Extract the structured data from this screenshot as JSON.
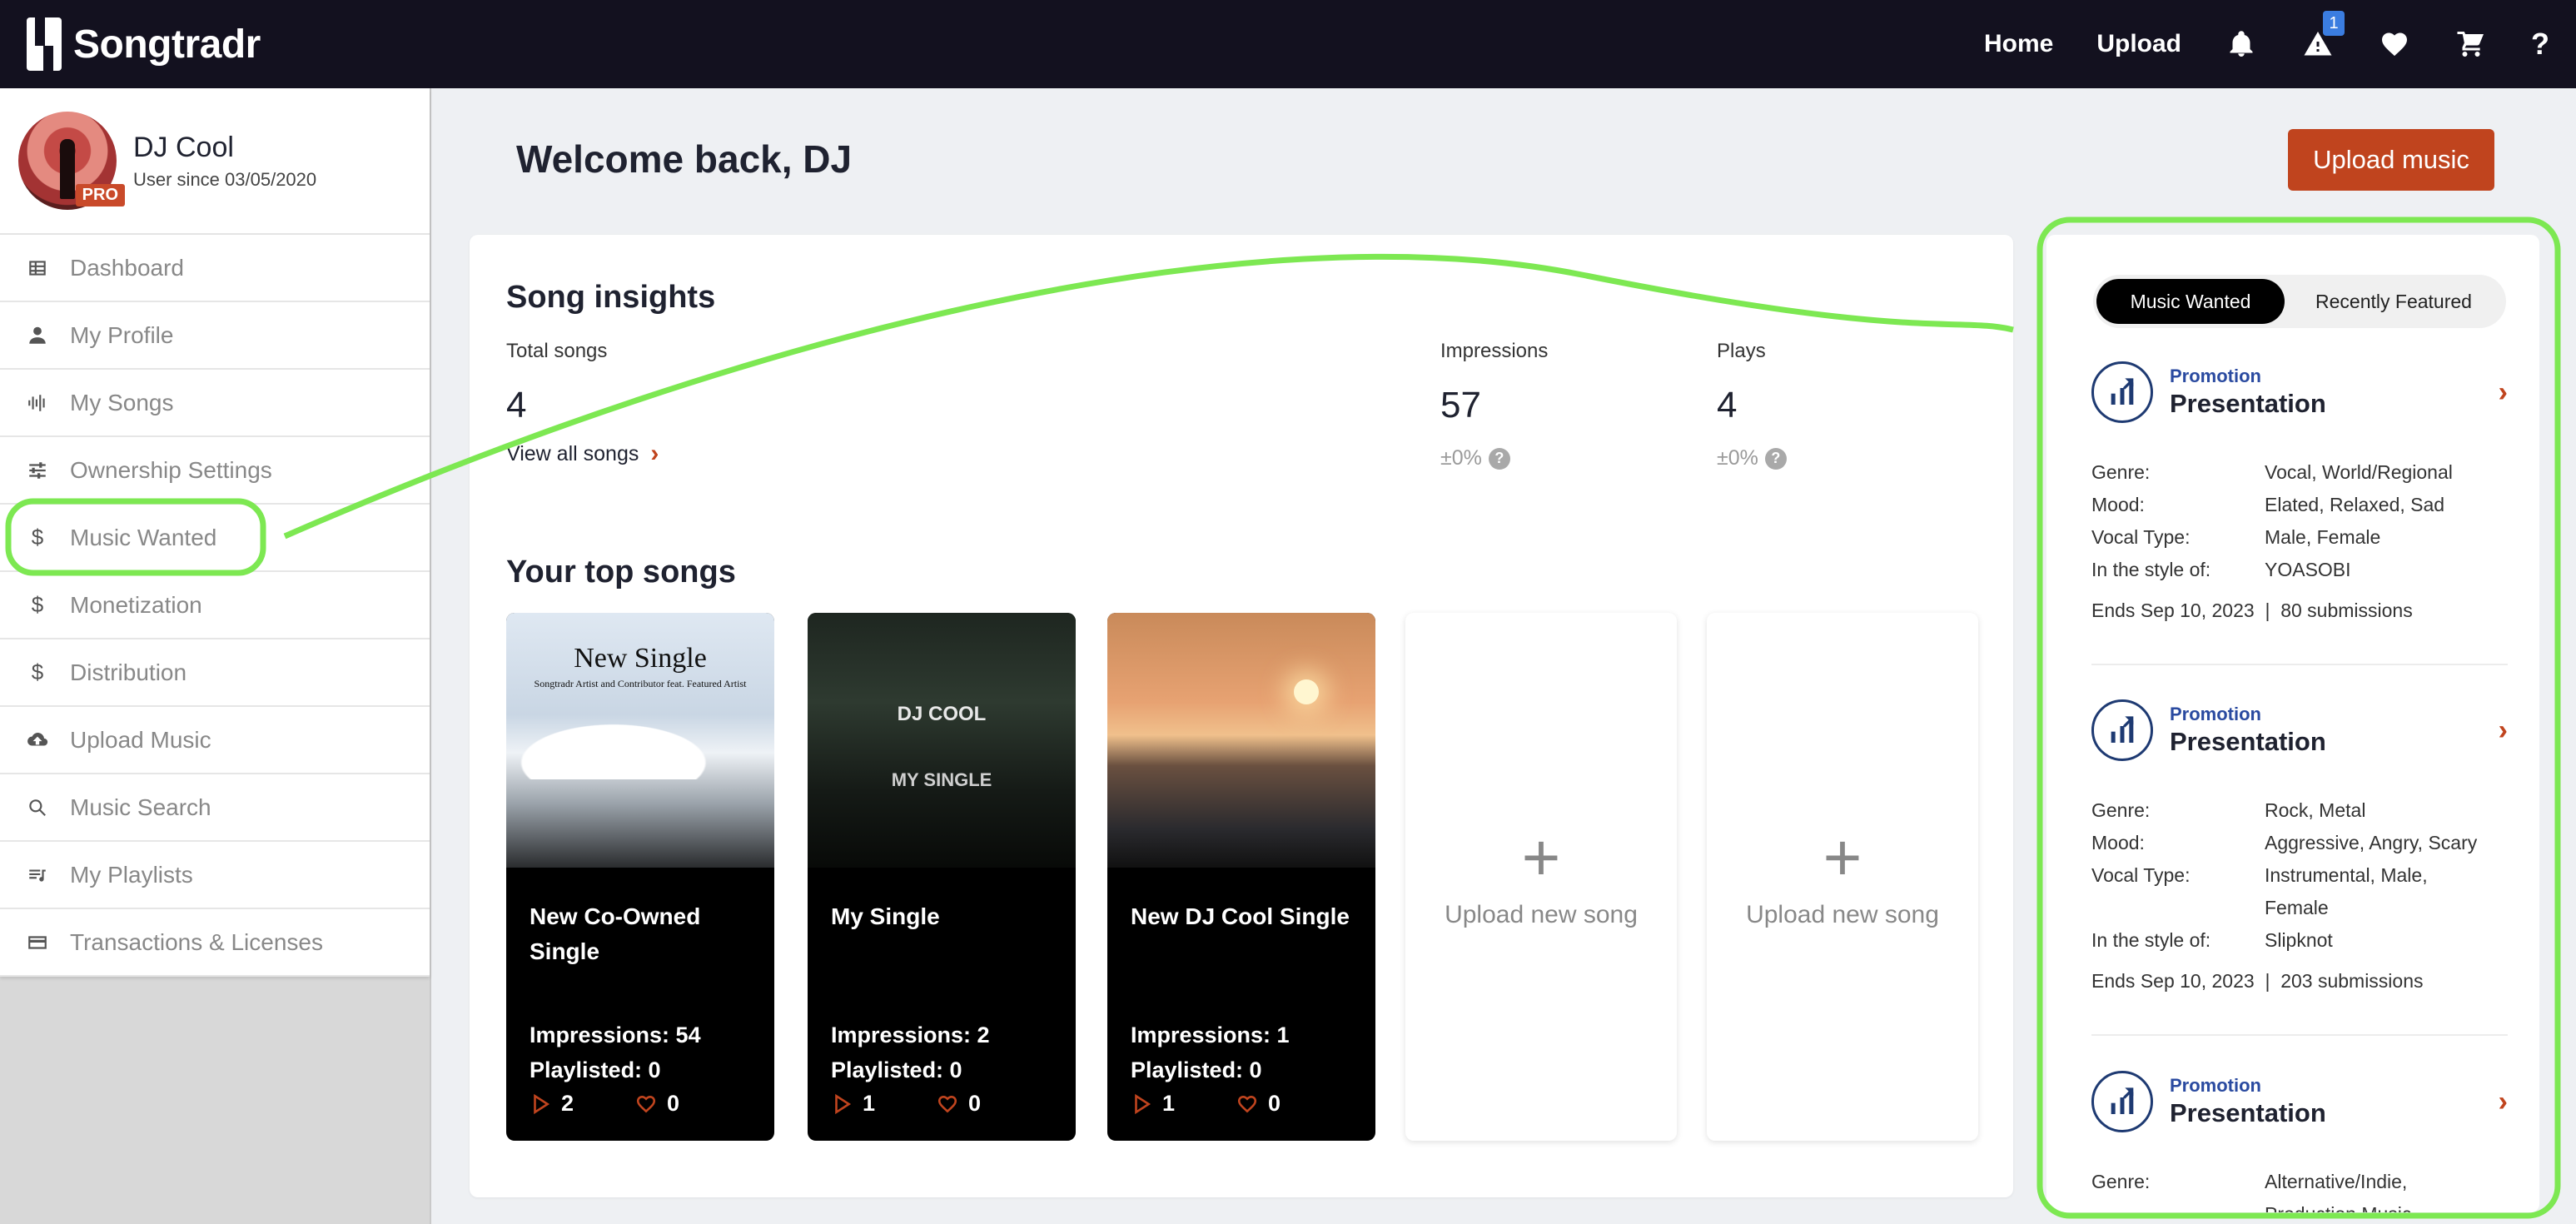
{
  "app": {
    "brand": "Songtradr"
  },
  "topnav": {
    "home": "Home",
    "upload": "Upload",
    "alert_badge": "1",
    "help": "?"
  },
  "profile": {
    "name": "DJ Cool",
    "since": "User since 03/05/2020",
    "badge": "PRO"
  },
  "sidebar": {
    "items": [
      {
        "label": "Dashboard",
        "icon": "table-icon"
      },
      {
        "label": "My Profile",
        "icon": "person-icon"
      },
      {
        "label": "My Songs",
        "icon": "waveform-icon"
      },
      {
        "label": "Ownership Settings",
        "icon": "sliders-icon"
      },
      {
        "label": "Music Wanted",
        "icon": "dollar-icon"
      },
      {
        "label": "Monetization",
        "icon": "dollar-icon"
      },
      {
        "label": "Distribution",
        "icon": "dollar-icon"
      },
      {
        "label": "Upload Music",
        "icon": "cloud-upload-icon"
      },
      {
        "label": "Music Search",
        "icon": "search-icon"
      },
      {
        "label": "My Playlists",
        "icon": "playlist-icon"
      },
      {
        "label": "Transactions & Licenses",
        "icon": "card-icon"
      }
    ]
  },
  "main": {
    "welcome": "Welcome back, DJ",
    "upload_button": "Upload music",
    "insights": {
      "title": "Song insights",
      "total_songs_label": "Total songs",
      "total_songs_value": "4",
      "view_all": "View all songs",
      "impressions_label": "Impressions",
      "impressions_value": "57",
      "impressions_delta": "±0%",
      "plays_label": "Plays",
      "plays_value": "4",
      "plays_delta": "±0%"
    },
    "top_songs_title": "Your top songs",
    "songs": [
      {
        "title": "New Co-Owned Single",
        "cover_title": "New Single",
        "cover_subtitle": "Songtradr Artist and Contributor feat. Featured Artist",
        "impressions": "Impressions: 54",
        "playlisted": "Playlisted: 0",
        "plays": "2",
        "likes": "0"
      },
      {
        "title": "My Single",
        "cover_title": "DJ COOL",
        "cover_subtitle": "MY SINGLE",
        "impressions": "Impressions: 2",
        "playlisted": "Playlisted: 0",
        "plays": "1",
        "likes": "0"
      },
      {
        "title": "New DJ Cool Single",
        "impressions": "Impressions: 1",
        "playlisted": "Playlisted: 0",
        "plays": "1",
        "likes": "0"
      }
    ],
    "upload_slots": [
      "Upload new song",
      "Upload new song"
    ]
  },
  "right_panel": {
    "tabs": {
      "active": "Music Wanted",
      "inactive": "Recently Featured"
    },
    "keys": {
      "genre": "Genre:",
      "mood": "Mood:",
      "vocal": "Vocal Type:",
      "style": "In the style of:"
    },
    "promos": [
      {
        "type": "Promotion",
        "name": "Presentation",
        "genre": "Vocal, World/Regional",
        "mood": "Elated, Relaxed, Sad",
        "vocal": "Male, Female",
        "style": "YOASOBI",
        "footer": "Ends Sep 10, 2023  |  80 submissions"
      },
      {
        "type": "Promotion",
        "name": "Presentation",
        "genre": "Rock, Metal",
        "mood": "Aggressive, Angry, Scary",
        "vocal": "Instrumental, Male, Female",
        "style": "Slipknot",
        "footer": "Ends Sep 10, 2023  |  203 submissions"
      },
      {
        "type": "Promotion",
        "name": "Presentation",
        "genre": "Alternative/Indie, Production Music,"
      }
    ]
  },
  "colors": {
    "topbar": "#13111f",
    "accent": "#c0441e",
    "annotation": "#7de852",
    "promo_icon": "#1e3a72"
  }
}
